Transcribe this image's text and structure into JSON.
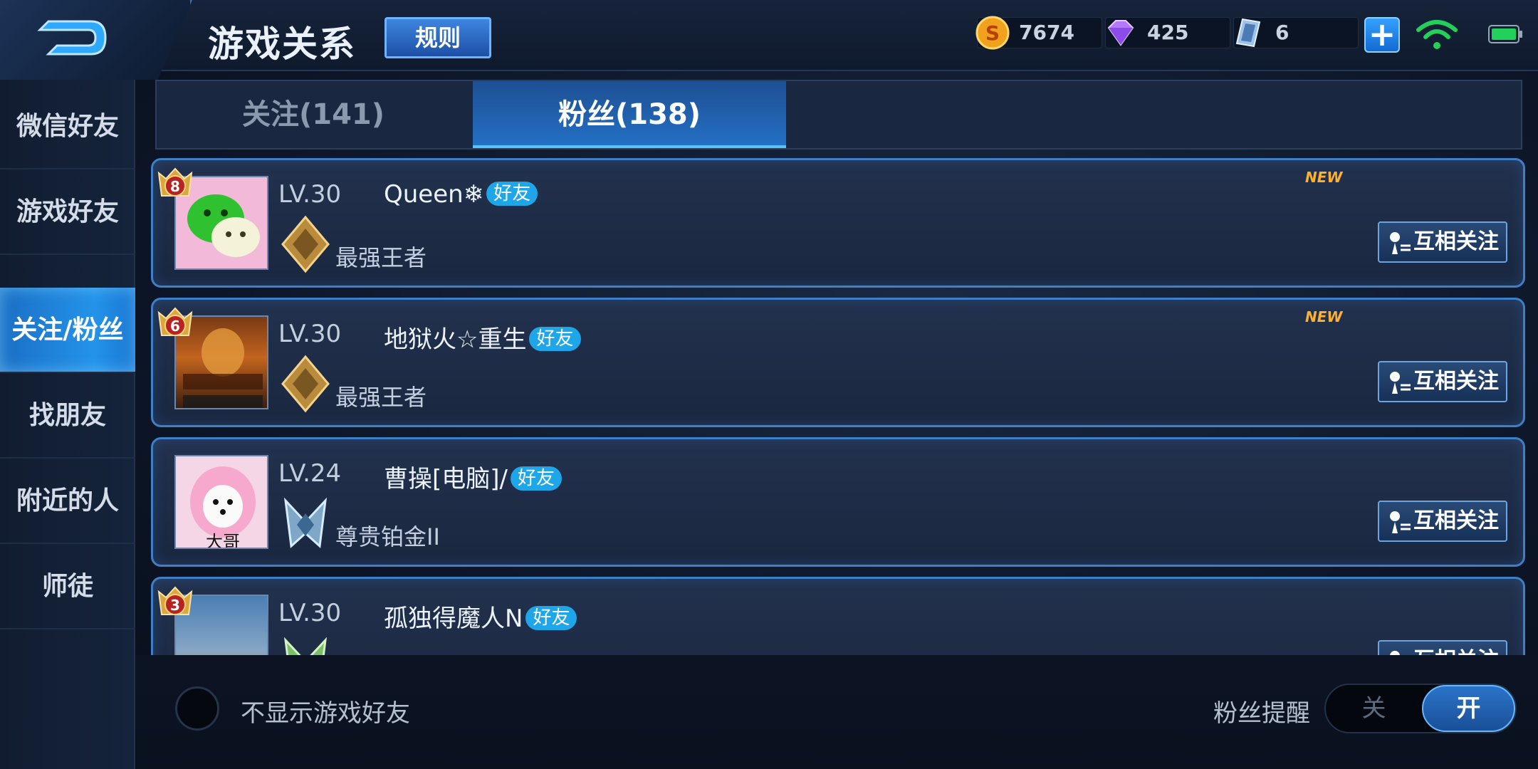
{
  "header": {
    "title": "游戏关系",
    "rules_label": "规则",
    "currencies": [
      {
        "name": "gold-coin",
        "value": "7674"
      },
      {
        "name": "diamond",
        "value": "425"
      },
      {
        "name": "coupon",
        "value": "6"
      }
    ],
    "plus_label": "+"
  },
  "sidebar": {
    "items": [
      {
        "label": "微信好友",
        "active": false
      },
      {
        "label": "游戏好友",
        "active": false
      },
      {
        "label": "关注/粉丝",
        "active": true
      },
      {
        "label": "找朋友",
        "active": false
      },
      {
        "label": "附近的人",
        "active": false
      },
      {
        "label": "师徒",
        "active": false
      }
    ]
  },
  "tabs": [
    {
      "label": "关注(141)",
      "active": false
    },
    {
      "label": "粉丝(138)",
      "active": true
    }
  ],
  "list": {
    "rows": [
      {
        "level": "LV.30",
        "name": "Queen❄",
        "tag": "好友",
        "rank": "最强王者",
        "badge": "8",
        "new": "NEW",
        "button": "互相关注"
      },
      {
        "level": "LV.30",
        "name": "地狱火☆重生",
        "tag": "好友",
        "rank": "最强王者",
        "badge": "6",
        "new": "NEW",
        "button": "互相关注"
      },
      {
        "level": "LV.24",
        "name": "曹操[电脑]/",
        "tag": "好友",
        "rank": "尊贵铂金II",
        "badge": "",
        "new": "",
        "button": "互相关注",
        "avatar_caption": "大哥"
      },
      {
        "level": "LV.30",
        "name": "孤独得魔人N",
        "tag": "好友",
        "rank": "",
        "badge": "3",
        "new": "",
        "button": "互相关注"
      }
    ]
  },
  "bottom": {
    "hide_friends_label": "不显示游戏好友",
    "notify_label": "粉丝提醒",
    "toggle_off": "关",
    "toggle_on": "开"
  },
  "colors": {
    "accent": "#2493ea",
    "tag": "#1ea6e8",
    "new": "#ffb02e"
  }
}
